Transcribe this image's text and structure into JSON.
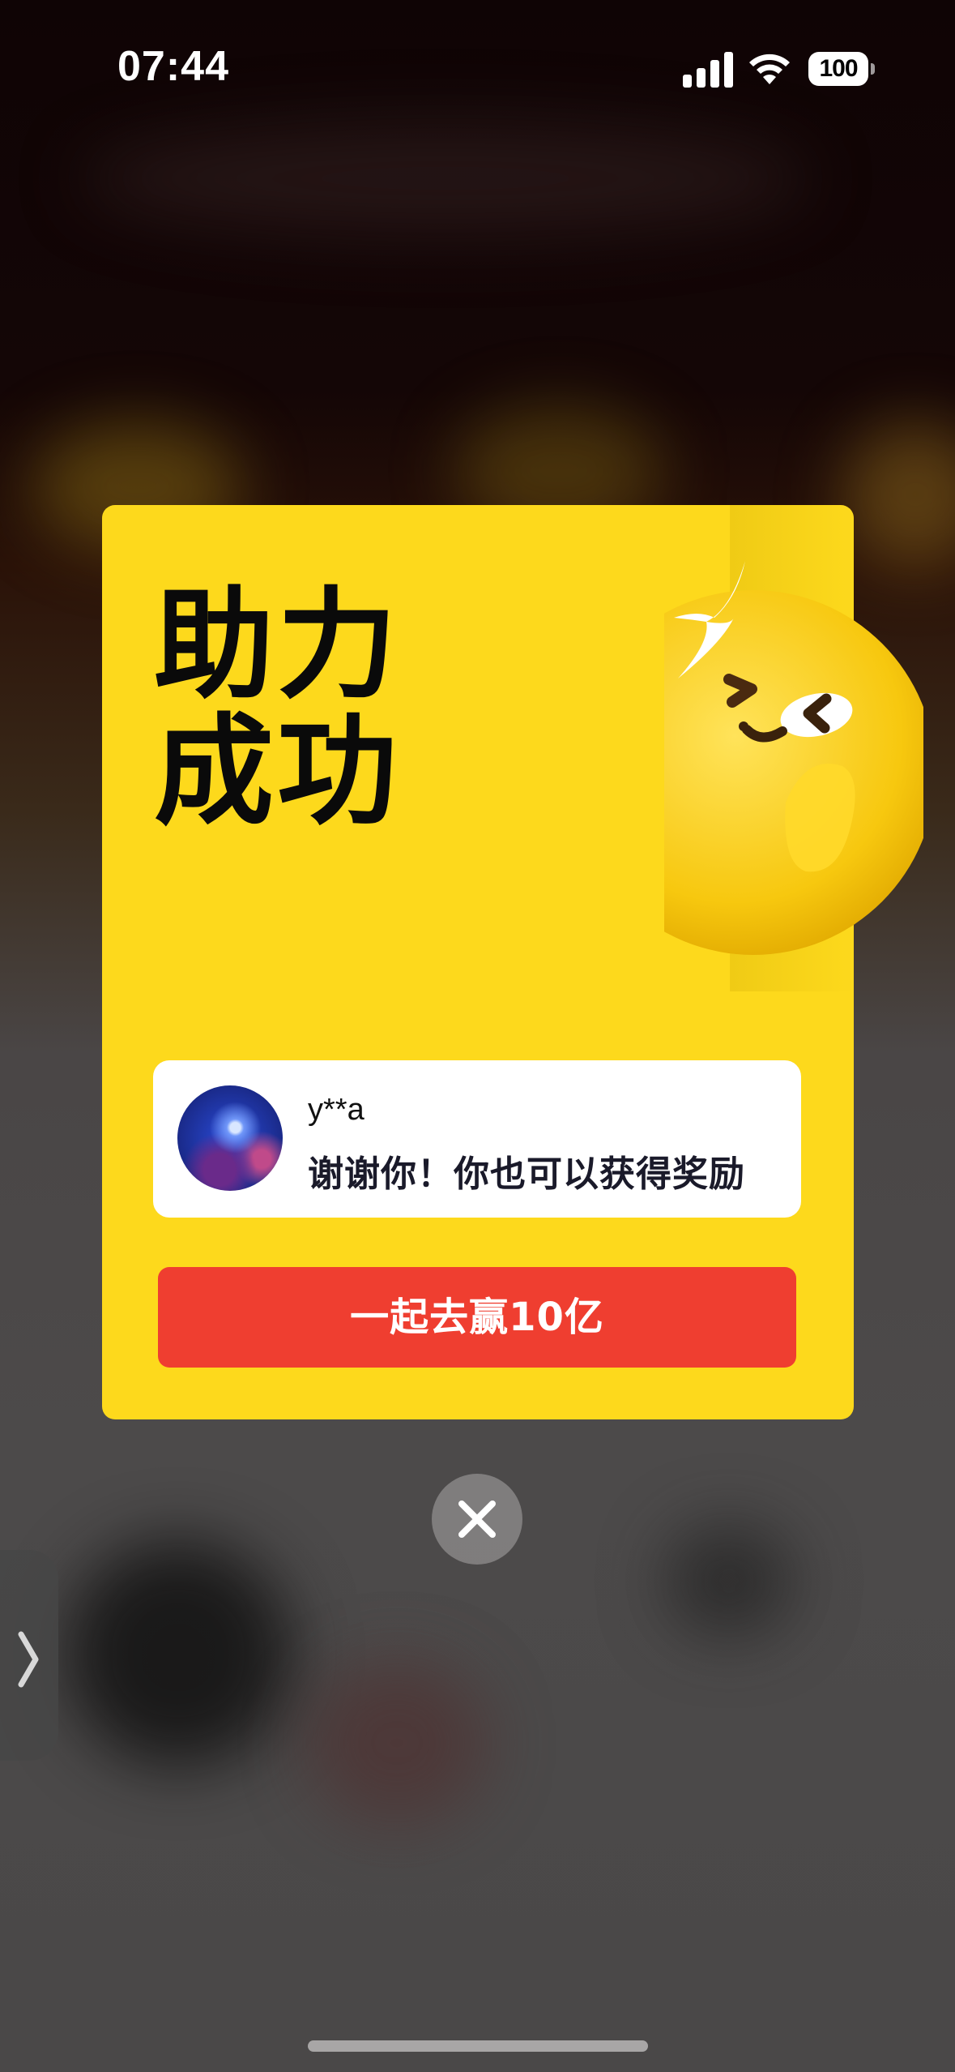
{
  "status_bar": {
    "time": "07:44",
    "battery_level": "100",
    "icons": [
      "signal-icon",
      "wifi-icon",
      "battery-icon"
    ]
  },
  "dialog": {
    "title_line1": "助力",
    "title_line2": "成功",
    "username": "y**a",
    "message": "谢谢你！你也可以获得奖励",
    "cta_label": "一起去赢10亿",
    "accent_color": "#fdd91c",
    "button_color": "#ef3e30",
    "mascot": "smiling-emoji-mascot",
    "sparkle": "sparkle-icon"
  },
  "close_icon": "close-icon",
  "side_tab_icon": "chevron-right-icon"
}
